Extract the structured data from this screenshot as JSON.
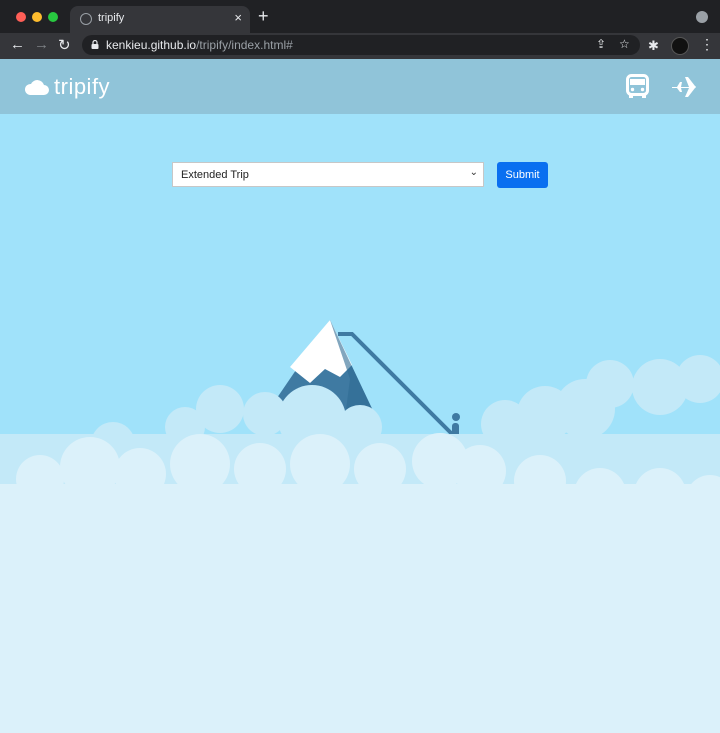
{
  "browser": {
    "tab_title": "tripify",
    "tab_close": "×",
    "new_tab": "+",
    "url_host": "kenkieu.github.io",
    "url_path": "/tripify/index.html#"
  },
  "site": {
    "logo_text": "tripify",
    "logo_icon": "cloud-icon",
    "nav_icons": [
      "bus-icon",
      "plane-icon"
    ],
    "trip_select": {
      "selected": "Extended Trip"
    },
    "submit_label": "Submit",
    "colors": {
      "header": "#90c4d9",
      "sky": "#a0e2fa",
      "button": "#0a6ff0",
      "mountain": "#3f7aa2",
      "clouds": "#dff2fb"
    }
  }
}
